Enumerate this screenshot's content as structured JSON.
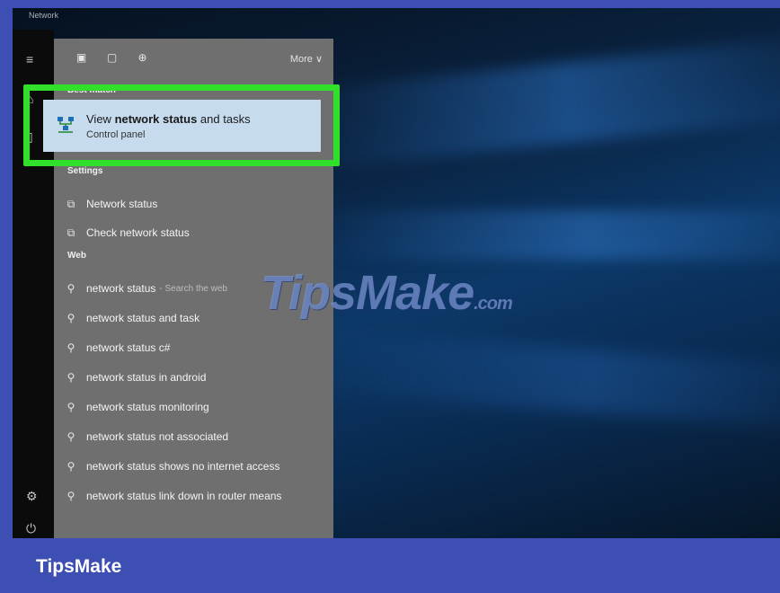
{
  "window": {
    "title": "Network"
  },
  "toolbar": {
    "more_label": "More ∨"
  },
  "sections": {
    "best_match": "Best match",
    "settings": "Settings",
    "web": "Web"
  },
  "best_match": {
    "title_prefix": "View ",
    "title_bold": "network status",
    "title_suffix": " and tasks",
    "subtitle": "Control panel"
  },
  "settings_items": [
    {
      "label": "Network status"
    },
    {
      "label": "Check network status"
    }
  ],
  "web_items": [
    {
      "label": "network status",
      "hint": "- Search the web"
    },
    {
      "label": "network status and task"
    },
    {
      "label": "network status c#"
    },
    {
      "label": "network status in android"
    },
    {
      "label": "network status monitoring"
    },
    {
      "label": "network status not associated"
    },
    {
      "label": "network status shows no internet access"
    },
    {
      "label": "network status link down in router means"
    }
  ],
  "watermark": {
    "text": "TipsMake",
    "suffix": ".com"
  },
  "footer": {
    "brand": "TipsMake"
  },
  "colors": {
    "frame": "#3e4fb3",
    "highlight": "#31e02b",
    "selected_bg": "#c6dcee",
    "panel_bg": "#6f6f6f"
  }
}
